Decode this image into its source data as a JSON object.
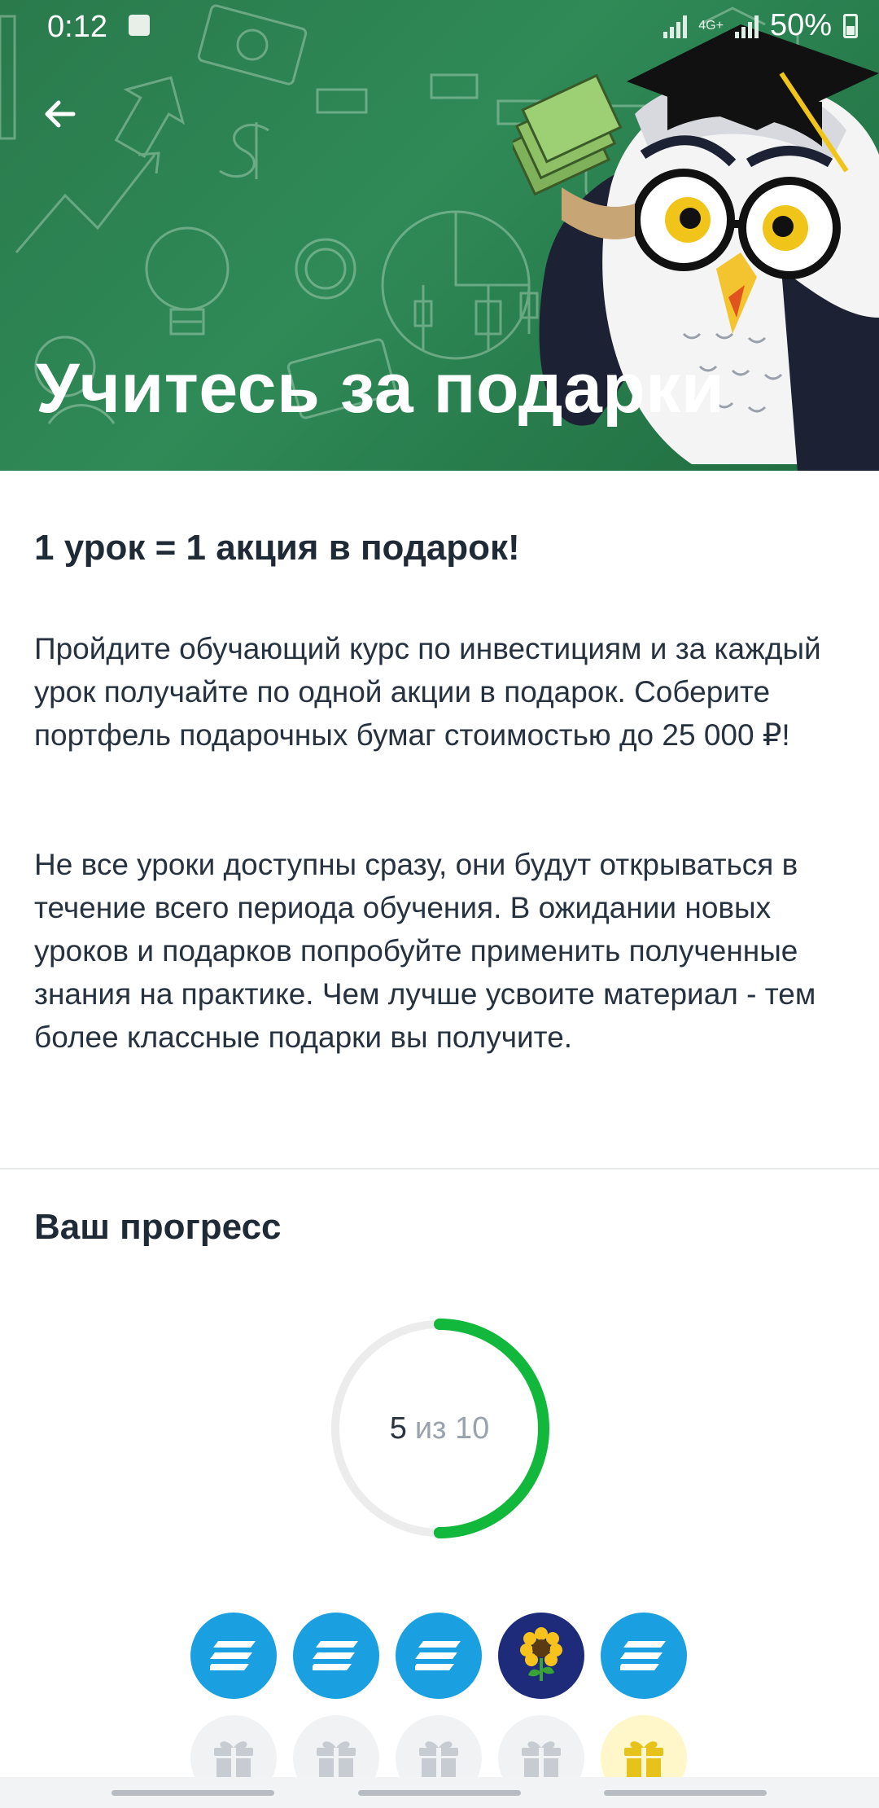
{
  "status_bar": {
    "time": "0:12",
    "network": "4G+",
    "battery": "50%"
  },
  "header": {
    "title": "Учитесь за подарки",
    "back_icon": "arrow-left-icon",
    "background_color": "#2f8a57"
  },
  "content": {
    "subtitle": "1 урок = 1 акция в подарок!",
    "paragraph1": "Пройдите обучающий курс по инвестициям и за каждый урок получайте по одной акции в подарок. Соберите портфель подарочных бумаг стоимостью до 25 000 ₽!",
    "paragraph2": "Не все уроки доступны сразу, они будут открываться в течение всего периода обучения. В ожидании новых уроков и подарков попробуйте применить полученные знания на практике. Чем лучше усвоите материал - тем более классные подарки вы получите."
  },
  "progress": {
    "title": "Ваш прогресс",
    "completed": "5",
    "total_label": "из 10",
    "fraction": 0.5,
    "ring_color": "#12b83c",
    "track_color": "#ececec",
    "earned_badges": [
      {
        "icon": "stock-stripes-icon",
        "color": "#1a9fe0"
      },
      {
        "icon": "stock-stripes-icon",
        "color": "#1a9fe0"
      },
      {
        "icon": "stock-stripes-icon",
        "color": "#1a9fe0"
      },
      {
        "icon": "sunflower-icon",
        "color": "#1d2b7a"
      },
      {
        "icon": "stock-stripes-icon",
        "color": "#1a9fe0"
      }
    ],
    "locked_gifts": [
      {
        "icon": "gift-icon",
        "state": "locked"
      },
      {
        "icon": "gift-icon",
        "state": "locked"
      },
      {
        "icon": "gift-icon",
        "state": "locked"
      },
      {
        "icon": "gift-icon",
        "state": "locked"
      },
      {
        "icon": "gift-icon",
        "state": "highlighted"
      }
    ]
  }
}
